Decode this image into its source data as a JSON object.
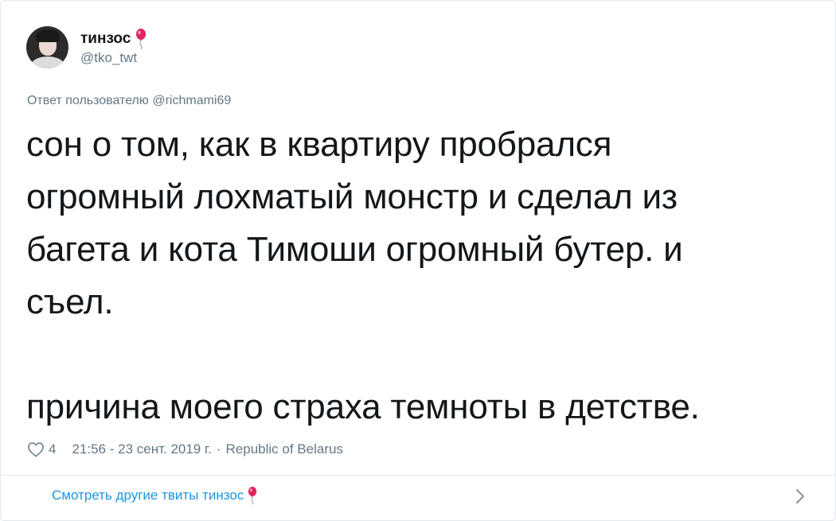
{
  "author": {
    "display_name": "тинзос",
    "handle": "@tko_twt",
    "avatar": "avatar-photo",
    "badge_icon": "balloon-icon"
  },
  "reply": {
    "prefix": "Ответ пользователю",
    "user": "@richmami69"
  },
  "tweet": {
    "lines": [
      "сон о том, как в квартиру пробрался",
      "огромный лохматый монстр и сделал из",
      "багета и кота Тимоши огромный бутер. и",
      "съел.",
      "причина моего страха темноты в детстве."
    ]
  },
  "meta": {
    "like_icon": "heart-icon",
    "likes": "4",
    "time": "21:56 - 23 сент. 2019 г.",
    "separator": "·",
    "location": "Republic of Belarus"
  },
  "footer": {
    "more_label": "Смотреть другие твиты тинзос",
    "chevron_icon": "chevron-right-icon"
  },
  "colors": {
    "text": "#14171a",
    "secondary": "#657786",
    "link": "#1b95e0",
    "border": "#e1e8ed",
    "balloon": "#e0245e"
  }
}
